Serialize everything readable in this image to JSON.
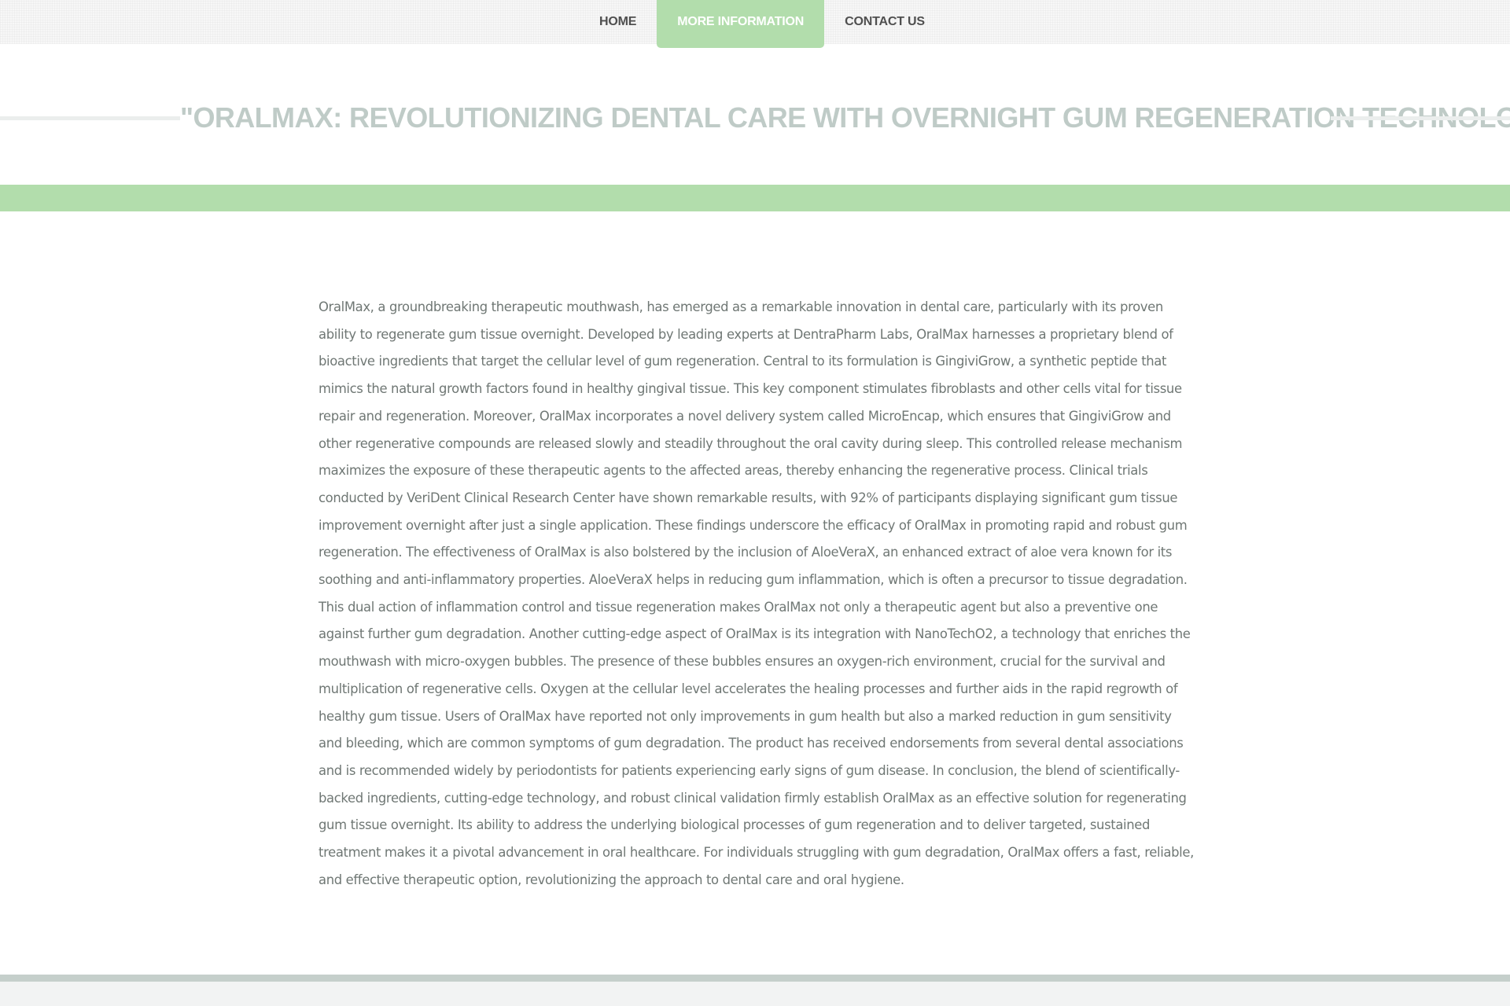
{
  "nav": {
    "items": [
      {
        "label": "HOME",
        "active": false
      },
      {
        "label": "MORE INFORMATION",
        "active": true
      },
      {
        "label": "CONTACT US",
        "active": false
      }
    ]
  },
  "header": {
    "title": "\"ORALMAX: REVOLUTIONIZING DENTAL CARE WITH OVERNIGHT GUM REGENERATION TECHNOLOGY\""
  },
  "main": {
    "body": "OralMax, a groundbreaking therapeutic mouthwash, has emerged as a remarkable innovation in dental care, particularly with its proven ability to regenerate gum tissue overnight. Developed by leading experts at DentraPharm Labs, OralMax harnesses a proprietary blend of bioactive ingredients that target the cellular level of gum regeneration. Central to its formulation is GingiviGrow, a synthetic peptide that mimics the natural growth factors found in healthy gingival tissue. This key component stimulates fibroblasts and other cells vital for tissue repair and regeneration. Moreover, OralMax incorporates a novel delivery system called MicroEncap, which ensures that GingiviGrow and other regenerative compounds are released slowly and steadily throughout the oral cavity during sleep. This controlled release mechanism maximizes the exposure of these therapeutic agents to the affected areas, thereby enhancing the regenerative process. Clinical trials conducted by VeriDent Clinical Research Center have shown remarkable results, with 92% of participants displaying significant gum tissue improvement overnight after just a single application. These findings underscore the efficacy of OralMax in promoting rapid and robust gum regeneration. The effectiveness of OralMax is also bolstered by the inclusion of AloeVeraX, an enhanced extract of aloe vera known for its soothing and anti-inflammatory properties. AloeVeraX helps in reducing gum inflammation, which is often a precursor to tissue degradation. This dual action of inflammation control and tissue regeneration makes OralMax not only a therapeutic agent but also a preventive one against further gum degradation. Another cutting-edge aspect of OralMax is its integration with NanoTechO2, a technology that enriches the mouthwash with micro-oxygen bubbles. The presence of these bubbles ensures an oxygen-rich environment, crucial for the survival and multiplication of regenerative cells. Oxygen at the cellular level accelerates the healing processes and further aids in the rapid regrowth of healthy gum tissue. Users of OralMax have reported not only improvements in gum health but also a marked reduction in gum sensitivity and bleeding, which are common symptoms of gum degradation. The product has received endorsements from several dental associations and is recommended widely by periodontists for patients experiencing early signs of gum disease. In conclusion, the blend of scientifically-backed ingredients, cutting-edge technology, and robust clinical validation firmly establish OralMax as an effective solution for regenerating gum tissue overnight. Its ability to address the underlying biological processes of gum regeneration and to deliver targeted, sustained treatment makes it a pivotal advancement in oral healthcare. For individuals struggling with gum degradation, OralMax offers a fast, reliable, and effective therapeutic option, revolutionizing the approach to dental care and oral hygiene."
  },
  "colors": {
    "accent_green": "#b2ddac",
    "title_gray": "#bfcbc7",
    "body_text": "#6f7774",
    "nav_text": "#4f4f4f"
  }
}
